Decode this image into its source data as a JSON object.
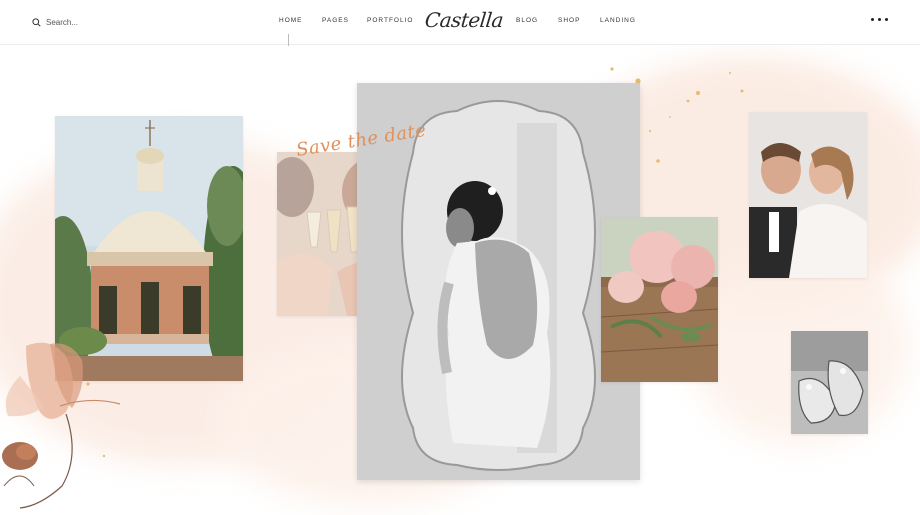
{
  "header": {
    "search_placeholder": "Search...",
    "nav_left": [
      "HOME",
      "PAGES",
      "PORTFOLIO"
    ],
    "logo": "Castella",
    "nav_right": [
      "BLOG",
      "SHOP",
      "LANDING"
    ]
  },
  "hero": {
    "script_text": "Save the date"
  },
  "icons": {
    "search": "search-icon",
    "menu": "more-dots-icon"
  },
  "colors": {
    "accent": "#e0905a",
    "wash": "#f6e1d6",
    "gold": "#e8c27a"
  }
}
